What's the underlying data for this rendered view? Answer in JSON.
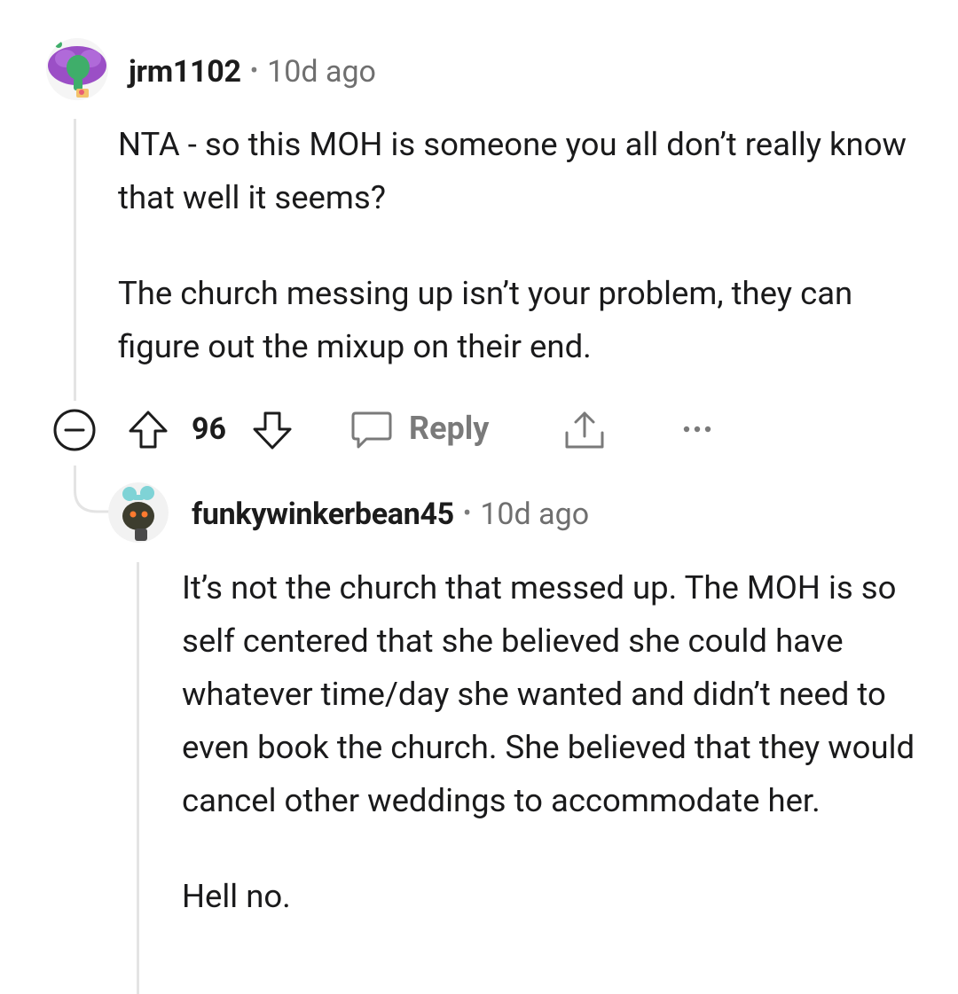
{
  "comment1": {
    "username": "jrm1102",
    "separator": "•",
    "time": "10d ago",
    "avatar_icon": "snoo-avatar-green-purple-hair",
    "paragraphs": [
      "NTA - so this MOH is someone you all don’t really know that well it seems?",
      "The church messing up isn’t your problem, they can figure out the mixup on their end."
    ],
    "actions": {
      "collapse_icon": "collapse-minus-icon",
      "upvote_icon": "upvote-arrow-icon",
      "score": "96",
      "downvote_icon": "downvote-arrow-icon",
      "reply_icon": "speech-bubble-icon",
      "reply_label": "Reply",
      "share_icon": "share-upload-icon",
      "more_icon": "more-dots-icon"
    }
  },
  "comment2": {
    "username": "funkywinkerbean45",
    "separator": "•",
    "time": "10d ago",
    "avatar_icon": "snoo-avatar-blue-hair-buns",
    "paragraphs": [
      "It’s not the church that messed up. The MOH is so self centered that she believed she could have whatever time/day she wanted and didn’t need to even book the church. She believed that they would cancel other weddings to accommodate her.",
      "Hell no."
    ]
  },
  "colors": {
    "text": "#1a1a1b",
    "meta": "#6f6f6f",
    "thread_line": "#e4e4e4",
    "icon": "#1c1c1c"
  }
}
